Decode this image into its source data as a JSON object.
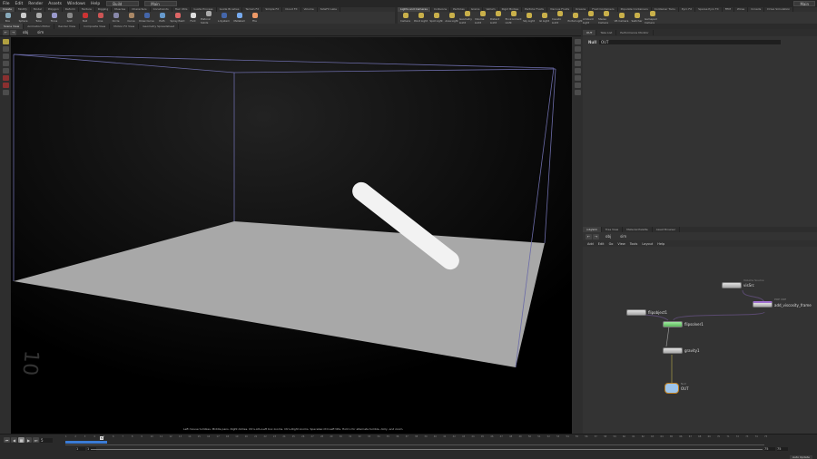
{
  "menu": [
    "File",
    "Edit",
    "Render",
    "Assets",
    "Windows",
    "Help"
  ],
  "desktop": {
    "build": "Build",
    "main": "Main",
    "main_right": "Main"
  },
  "shelf_left": {
    "tabs": [
      "Create",
      "Modify",
      "Model",
      "Polygon",
      "Deform",
      "Texture",
      "Rigging",
      "Muscles",
      "Characters",
      "Constraints",
      "Hair Utils",
      "Guide Process",
      "Guide Brushes",
      "Terrain FX",
      "Simple FX",
      "Cloud FX",
      "Volume",
      "SideFX Labs"
    ],
    "tools": [
      "Box",
      "Sphere",
      "Tube",
      "Torus",
      "Grid",
      "Null",
      "Line",
      "Circle",
      "Curve",
      "Draw Curve",
      "Path",
      "Spray Paint",
      "Font",
      "Platonic Solids",
      "L-System",
      "Metaball",
      "File"
    ]
  },
  "shelf_right": {
    "tabs": [
      "Lights and Cameras",
      "Collisions",
      "Particles",
      "Grains",
      "Vellum",
      "Rigid Bodies",
      "Particle Fluids",
      "Viscous Fluids",
      "Oceans",
      "Fluid Containers",
      "Populate Containers",
      "Container Tools",
      "Pyro FX",
      "Sparse Pyro FX",
      "FEM",
      "Wires",
      "Crowds",
      "Drive Simulation"
    ],
    "tools": [
      "Camera",
      "Point Light",
      "Spot Light",
      "Area Light",
      "Geometry Light",
      "Volume Light",
      "Distant Light",
      "Environment Light",
      "Sky Light",
      "GI Light",
      "Caustic Light",
      "Portal Light",
      "Ambient Light",
      "Stereo Camera",
      "VR Camera",
      "Switcher",
      "Gamepad Camera"
    ]
  },
  "pane_tabs": [
    "Scene View",
    "Animation Editor",
    "Render View",
    "Composite View",
    "Motion FX View",
    "Geometry Spreadsheet"
  ],
  "right_top_tabs": [
    "OUT",
    "Take List",
    "Performance Monitor"
  ],
  "path": {
    "obj": "obj",
    "node": "sim"
  },
  "viewport": {
    "title": "View",
    "persp": "Persp",
    "cam": "No cam",
    "hint": "Left mouse tumbles. Middle pans. Right dollies. Ctrl+Alt+Left box zooms. Ctrl+Right zooms. Spacebar-Ctrl-Left tilts. Hold L for alternate tumble, dolly, and zoom.",
    "floor_label": "10"
  },
  "params": {
    "type": "Null",
    "name": "OUT"
  },
  "network": {
    "tabs": [
      "/obj/sim",
      "Tree View",
      "Material Palette",
      "Asset Browser"
    ],
    "menu": [
      "Add",
      "Edit",
      "Go",
      "View",
      "Tools",
      "Layout",
      "Help"
    ],
    "nodes": [
      {
        "type": "Volume Source",
        "name": "visSrc"
      },
      {
        "type": "POP VOP",
        "name": "add_viscosity_frame"
      },
      {
        "type": "",
        "name": "flipobject1"
      },
      {
        "type": "",
        "name": "flipsolver1"
      },
      {
        "type": "",
        "name": "gravity1"
      },
      {
        "type": "Null",
        "name": "OUT"
      }
    ]
  },
  "timeline": {
    "current_frame": "5",
    "start": "1",
    "start2": "1",
    "end": "75",
    "end2": "75",
    "ticks": [
      "1",
      "2",
      "3",
      "4",
      "5",
      "6",
      "7",
      "8",
      "9",
      "10",
      "11",
      "12",
      "13",
      "14",
      "15",
      "16",
      "17",
      "18",
      "19",
      "20",
      "21",
      "22",
      "23",
      "24",
      "25",
      "26",
      "27",
      "28",
      "29",
      "30",
      "31",
      "32",
      "33",
      "34",
      "35",
      "36",
      "37",
      "38",
      "39",
      "40",
      "41",
      "42",
      "43",
      "44",
      "45",
      "46",
      "47",
      "48",
      "49",
      "50",
      "51",
      "52",
      "53",
      "54",
      "55",
      "56",
      "57",
      "58",
      "59",
      "60",
      "61",
      "62",
      "63",
      "64",
      "65",
      "66",
      "67",
      "68",
      "69",
      "70",
      "71",
      "72",
      "73",
      "74",
      "75"
    ],
    "cached_fraction": 0.06,
    "update_mode": "Auto Update"
  },
  "colors": {
    "accent": "#3a7bd5",
    "solver": "#7fd37f",
    "bbox": "#6b6ba8"
  }
}
